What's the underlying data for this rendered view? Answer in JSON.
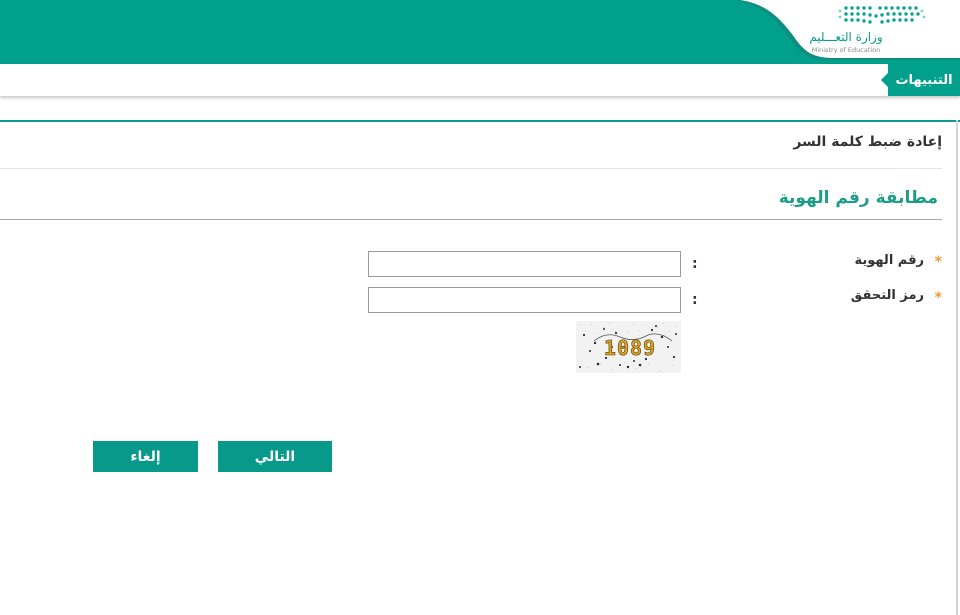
{
  "brand": {
    "name_ar": "وزارة التعـــليم",
    "name_en": "Ministry of Education",
    "colors": {
      "primary": "#00a08c",
      "accent_star": "#f29a2e",
      "section_title": "#1d9c88"
    }
  },
  "notifications_tab": {
    "label": "التنبيهات"
  },
  "page": {
    "title": "إعادة ضبط كلمة السر",
    "section_title": "مطابقة رقم الهوية"
  },
  "form": {
    "id_number": {
      "label": "رقم الهوية",
      "required_mark": "*",
      "separator": ":",
      "value": ""
    },
    "captcha_code": {
      "label": "رمز التحقق",
      "required_mark": "*",
      "separator": ":",
      "value": ""
    },
    "captcha_image": {
      "text": "1089"
    }
  },
  "actions": {
    "next_label": "التالي",
    "cancel_label": "إلغاء"
  }
}
